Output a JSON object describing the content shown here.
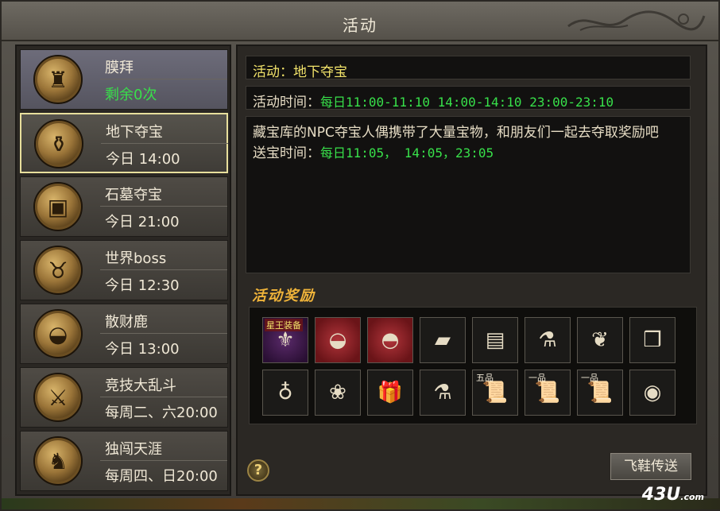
{
  "window": {
    "title": "活动"
  },
  "activities": [
    {
      "name": "膜拜",
      "time": "剩余0次",
      "time_green": true,
      "icon": "warrior-statue-icon",
      "glyph": "♜"
    },
    {
      "name": "地下夺宝",
      "time": "今日 14:00",
      "time_green": false,
      "icon": "treasure-pile-icon",
      "glyph": "⚱"
    },
    {
      "name": "石墓夺宝",
      "time": "今日 21:00",
      "time_green": false,
      "icon": "treasure-chest-icon",
      "glyph": "▣"
    },
    {
      "name": "世界boss",
      "time": "今日 12:30",
      "time_green": false,
      "icon": "bull-demon-icon",
      "glyph": "♉"
    },
    {
      "name": "散财鹿",
      "time": "今日 13:00",
      "time_green": false,
      "icon": "gold-ingot-icon",
      "glyph": "◒"
    },
    {
      "name": "竞技大乱斗",
      "time": "每周二、六20:00",
      "time_green": false,
      "icon": "crossed-swords-icon",
      "glyph": "⚔"
    },
    {
      "name": "独闯天涯",
      "time": "每周四、日20:00",
      "time_green": false,
      "icon": "warrior-figure-icon",
      "glyph": "♞"
    }
  ],
  "selected_index": 1,
  "detail": {
    "activity_label": "活动：",
    "activity_name": "地下夺宝",
    "time_label": "活动时间：",
    "time_value": "每日11:00-11:10 14:00-14:10 23:00-23:10",
    "description": "藏宝库的NPC夺宝人偶携带了大量宝物，和朋友们一起去夺取奖励吧",
    "send_label": "送宝时间：",
    "send_value": "每日11:05， 14:05，23:05"
  },
  "rewards": {
    "title": "活动奖励",
    "items": [
      {
        "icon": "star-king-equipment-icon",
        "glyph": "⚜",
        "tag": "星王装备",
        "style": "purple"
      },
      {
        "icon": "gold-ingot-icon",
        "glyph": "◒",
        "tag": "",
        "style": "red"
      },
      {
        "icon": "silver-ingot-icon",
        "glyph": "◓",
        "tag": "",
        "style": "red"
      },
      {
        "icon": "gold-bar-icon",
        "glyph": "▰",
        "tag": "",
        "style": ""
      },
      {
        "icon": "skill-book-icon",
        "glyph": "▤",
        "tag": "",
        "style": ""
      },
      {
        "icon": "blue-potion-icon",
        "glyph": "⚗",
        "tag": "",
        "style": ""
      },
      {
        "icon": "red-ribbon-icon",
        "glyph": "❦",
        "tag": "",
        "style": ""
      },
      {
        "icon": "gift-box-icon",
        "glyph": "❒",
        "tag": "",
        "style": ""
      },
      {
        "icon": "gourd-icon",
        "glyph": "♁",
        "tag": "",
        "style": ""
      },
      {
        "icon": "red-money-bag-icon",
        "glyph": "❀",
        "tag": "",
        "style": ""
      },
      {
        "icon": "red-gift-box-icon",
        "glyph": "🎁",
        "tag": "",
        "style": ""
      },
      {
        "icon": "green-potion-icon",
        "glyph": "⚗",
        "tag": "",
        "style": ""
      },
      {
        "icon": "scroll-icon",
        "glyph": "📜",
        "tag": "五品",
        "style": ""
      },
      {
        "icon": "scroll-icon",
        "glyph": "📜",
        "tag": "一品",
        "style": ""
      },
      {
        "icon": "scroll-icon",
        "glyph": "📜",
        "tag": "一品",
        "style": ""
      },
      {
        "icon": "jade-orb-icon",
        "glyph": "◉",
        "tag": "",
        "style": ""
      }
    ]
  },
  "buttons": {
    "help": "?",
    "teleport": "飞鞋传送"
  },
  "watermark": {
    "main": "43U",
    "sub": ".com"
  }
}
